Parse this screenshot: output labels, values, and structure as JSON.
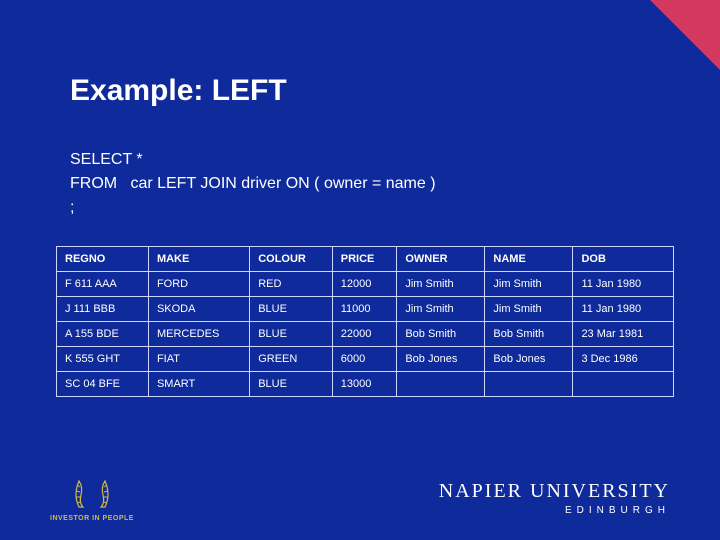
{
  "title": "Example: LEFT",
  "sql_lines": [
    "SELECT *",
    "FROM   car LEFT JOIN driver ON ( owner = name )",
    ";"
  ],
  "table": {
    "headers": [
      "REGNO",
      "MAKE",
      "COLOUR",
      "PRICE",
      "OWNER",
      "NAME",
      "DOB"
    ],
    "rows": [
      [
        "F 611 AAA",
        "FORD",
        "RED",
        "12000",
        "Jim Smith",
        "Jim Smith",
        "11 Jan 1980"
      ],
      [
        "J 111 BBB",
        "SKODA",
        "BLUE",
        "11000",
        "Jim Smith",
        "Jim Smith",
        "11 Jan 1980"
      ],
      [
        "A 155 BDE",
        "MERCEDES",
        "BLUE",
        "22000",
        "Bob Smith",
        "Bob Smith",
        "23 Mar 1981"
      ],
      [
        "K 555 GHT",
        "FIAT",
        "GREEN",
        "6000",
        "Bob Jones",
        "Bob Jones",
        "3 Dec 1986"
      ],
      [
        "SC 04 BFE",
        "SMART",
        "BLUE",
        "13000",
        "",
        "",
        ""
      ]
    ]
  },
  "footer": {
    "iip_label": "INVESTOR IN PEOPLE",
    "university": "NAPIER UNIVERSITY",
    "university_sub": "EDINBURGH"
  }
}
